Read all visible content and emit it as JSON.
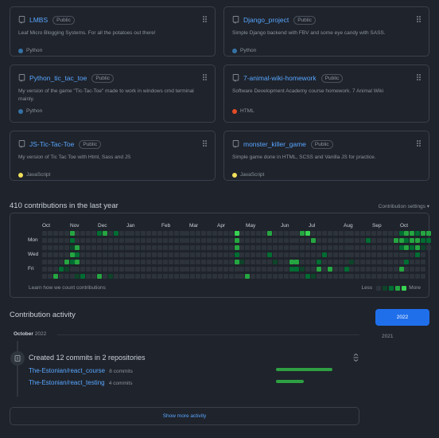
{
  "pinned": [
    {
      "name": "LMBS",
      "badge": "Public",
      "description": "Leaf Micro Blogging Systems. For all the potatoes out there!",
      "language": "Python",
      "lang_color": "#3572A5"
    },
    {
      "name": "Django_project",
      "badge": "Public",
      "description": "Simple Django backend with FBV and some eye candy with SASS.",
      "language": "Python",
      "lang_color": "#3572A5"
    },
    {
      "name": "Python_tic_tac_toe",
      "badge": "Public",
      "description": "My version of the game \"Tic-Tac-Toe\" made to work in windows cmd terminal mainly.",
      "language": "Python",
      "lang_color": "#3572A5"
    },
    {
      "name": "7-animal-wiki-homework",
      "badge": "Public",
      "description": "Software Development Academy course homework. 7 Animal Wiki",
      "language": "HTML",
      "lang_color": "#e34c26"
    },
    {
      "name": "JS-Tic-Tac-Toe",
      "badge": "Public",
      "description": "My version of Tic Tac Toe with Html, Sass and JS",
      "language": "JavaScript",
      "lang_color": "#f1e05a"
    },
    {
      "name": "monster_killer_game",
      "badge": "Public",
      "description": "Simple game done in HTML, SCSS and Vanilla JS for practice.",
      "language": "JavaScript",
      "lang_color": "#f1e05a"
    }
  ],
  "contributions": {
    "title": "410 contributions in the last year",
    "settings_label": "Contribution settings ▾",
    "months": [
      "Oct",
      "Nov",
      "Dec",
      "Jan",
      "Feb",
      "Mar",
      "Apr",
      "May",
      "Jun",
      "Jul",
      "Aug",
      "Sep",
      "Oct"
    ],
    "days": [
      "Mon",
      "Wed",
      "Fri"
    ],
    "learn_text": "Learn how we count contributions",
    "less_label": "Less",
    "more_label": "More",
    "colors": [
      "#2d333b",
      "#0e4429",
      "#006d32",
      "#26a641",
      "#39d353"
    ],
    "active_cells": [
      [
        2,
        6,
        3
      ],
      [
        3,
        5,
        2
      ],
      [
        4,
        4,
        3
      ],
      [
        4,
        5,
        1
      ],
      [
        5,
        0,
        3
      ],
      [
        5,
        1,
        2
      ],
      [
        5,
        2,
        1
      ],
      [
        5,
        3,
        3
      ],
      [
        5,
        4,
        2
      ],
      [
        6,
        2,
        3
      ],
      [
        6,
        3,
        2
      ],
      [
        6,
        4,
        3
      ],
      [
        6,
        6,
        1
      ],
      [
        7,
        6,
        2
      ],
      [
        10,
        0,
        2
      ],
      [
        10,
        6,
        3
      ],
      [
        11,
        0,
        3
      ],
      [
        12,
        6,
        1
      ],
      [
        13,
        0,
        2
      ],
      [
        35,
        0,
        4
      ],
      [
        35,
        1,
        3
      ],
      [
        35,
        2,
        3
      ],
      [
        35,
        3,
        2
      ],
      [
        35,
        4,
        3
      ],
      [
        36,
        4,
        1
      ],
      [
        37,
        6,
        3
      ],
      [
        41,
        0,
        3
      ],
      [
        41,
        3,
        2
      ],
      [
        42,
        4,
        1
      ],
      [
        45,
        4,
        3
      ],
      [
        45,
        5,
        2
      ],
      [
        46,
        4,
        3
      ],
      [
        46,
        5,
        2
      ],
      [
        47,
        0,
        3
      ],
      [
        47,
        5,
        1
      ],
      [
        48,
        0,
        4
      ],
      [
        48,
        6,
        2
      ],
      [
        49,
        1,
        3
      ],
      [
        49,
        6,
        1
      ],
      [
        50,
        4,
        2
      ],
      [
        50,
        5,
        3
      ],
      [
        51,
        3,
        2
      ],
      [
        52,
        5,
        3
      ],
      [
        55,
        5,
        2
      ],
      [
        56,
        4,
        1
      ],
      [
        59,
        1,
        2
      ],
      [
        64,
        1,
        3
      ],
      [
        65,
        0,
        2
      ],
      [
        65,
        1,
        3
      ],
      [
        65,
        2,
        2
      ],
      [
        65,
        5,
        3
      ],
      [
        66,
        0,
        3
      ],
      [
        66,
        1,
        2
      ],
      [
        66,
        2,
        3
      ],
      [
        66,
        4,
        2
      ],
      [
        67,
        0,
        3
      ],
      [
        67,
        1,
        3
      ],
      [
        67,
        2,
        2
      ],
      [
        68,
        0,
        2
      ],
      [
        68,
        1,
        3
      ],
      [
        68,
        2,
        3
      ],
      [
        68,
        3,
        2
      ],
      [
        69,
        0,
        3
      ],
      [
        69,
        1,
        2
      ],
      [
        69,
        2,
        1
      ],
      [
        70,
        0,
        3
      ],
      [
        70,
        1,
        2
      ]
    ]
  },
  "activity": {
    "title": "Contribution activity",
    "years": [
      "2022",
      "2021"
    ],
    "month": "October",
    "month_year": "2022",
    "commit_title": "Created 12 commits in 2 repositories",
    "repos": [
      {
        "name": "The-Estonian/react_course",
        "count": "8 commits",
        "share": 0.67
      },
      {
        "name": "The-Estonian/react_testing",
        "count": "4 commits",
        "share": 0.33
      }
    ],
    "show_more": "Show more activity"
  }
}
